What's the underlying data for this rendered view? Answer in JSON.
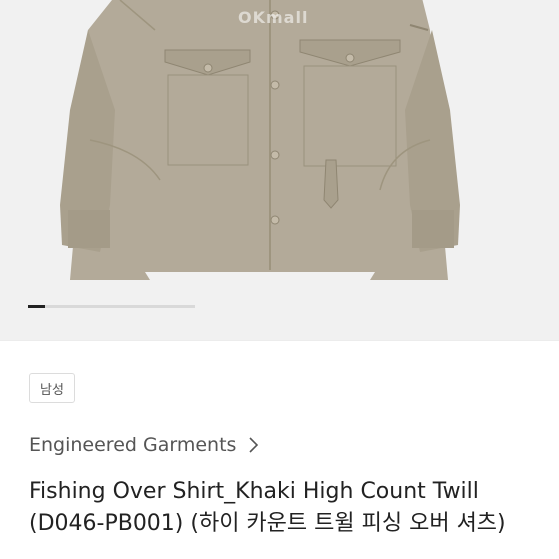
{
  "gallery": {
    "watermark": "OKmall",
    "progress": 0.1,
    "image_alt": "product-shirt-image"
  },
  "product": {
    "gender_tag": "남성",
    "brand": "Engineered Garments",
    "title": "Fishing Over Shirt_Khaki High Count Twill (D046-PB001) (하이 카운트 트윌 피싱 오버 셔츠)"
  },
  "colors": {
    "shirt": "#b3aa99",
    "shirt_shadow": "#9e957f",
    "gallery_bg": "#f1f1f1",
    "text": "#222222",
    "muted": "#555555"
  },
  "icons": {
    "brand_arrow": "chevron-right-icon"
  }
}
